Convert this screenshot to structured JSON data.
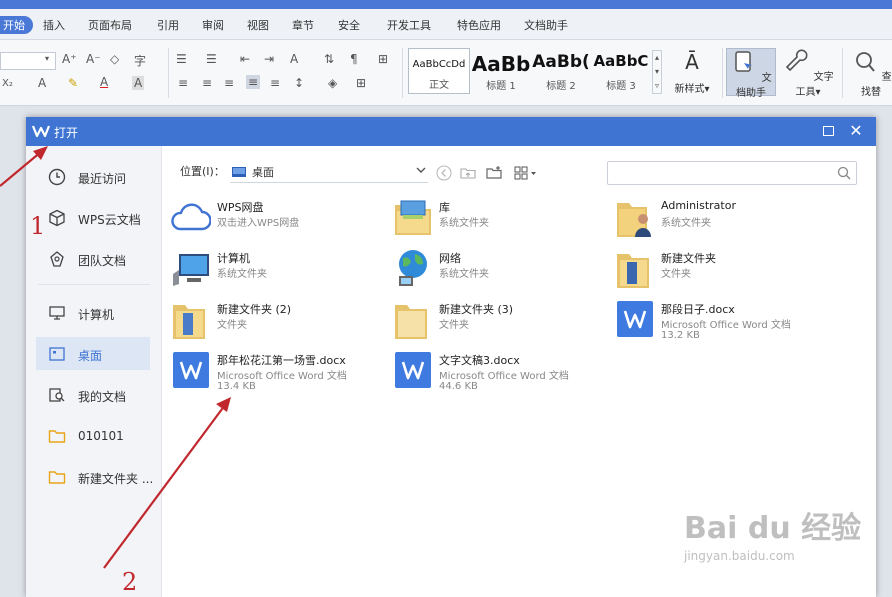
{
  "ribbon": {
    "menu": [
      "开始",
      "插入",
      "页面布局",
      "引用",
      "审阅",
      "视图",
      "章节",
      "安全",
      "开发工具",
      "特色应用",
      "文档助手"
    ],
    "styles": [
      {
        "sample": "AaBbCcDd",
        "name": "正文"
      },
      {
        "sample": "AaBb",
        "name": "标题 1"
      },
      {
        "sample": "AaBb(",
        "name": "标题 2"
      },
      {
        "sample": "AaBbC",
        "name": "标题 3"
      }
    ],
    "new_style": "新样式",
    "doc_helper": "文档助手",
    "text_tools": "文字工具",
    "find_replace": "查找替"
  },
  "dialog": {
    "title": "打开",
    "sidebar": [
      {
        "label": "最近访问",
        "icon": "clock-icon"
      },
      {
        "label": "WPS云文档",
        "icon": "cube-icon"
      },
      {
        "label": "团队文档",
        "icon": "team-icon"
      },
      {
        "label": "计算机",
        "icon": "monitor-icon"
      },
      {
        "label": "桌面",
        "icon": "desktop-icon"
      },
      {
        "label": "我的文档",
        "icon": "documents-icon"
      },
      {
        "label": "010101",
        "icon": "folder-icon"
      },
      {
        "label": "新建文件夹 ...",
        "icon": "folder-icon"
      }
    ],
    "location_label": "位置(I)：",
    "location_value": "桌面",
    "search_placeholder": "",
    "files": [
      {
        "name": "WPS网盘",
        "type": "双击进入WPS网盘",
        "size": "",
        "icon": "cloud-icon"
      },
      {
        "name": "库",
        "type": "系统文件夹",
        "size": "",
        "icon": "library-folder-icon"
      },
      {
        "name": "Administrator",
        "type": "系统文件夹",
        "size": "",
        "icon": "user-folder-icon"
      },
      {
        "name": "计算机",
        "type": "系统文件夹",
        "size": "",
        "icon": "computer-icon"
      },
      {
        "name": "网络",
        "type": "系统文件夹",
        "size": "",
        "icon": "network-globe-icon"
      },
      {
        "name": "新建文件夹",
        "type": "文件夹",
        "size": "",
        "icon": "folder-open-icon"
      },
      {
        "name": "新建文件夹 (2)",
        "type": "文件夹",
        "size": "",
        "icon": "folder-open-icon"
      },
      {
        "name": "新建文件夹 (3)",
        "type": "文件夹",
        "size": "",
        "icon": "folder-icon"
      },
      {
        "name": "那段日子.docx",
        "type": "Microsoft Office Word 文档",
        "size": "13.2 KB",
        "icon": "wps-doc-icon"
      },
      {
        "name": "那年松花江第一场雪.docx",
        "type": "Microsoft Office Word 文档",
        "size": "13.4 KB",
        "icon": "wps-doc-icon"
      },
      {
        "name": "文字文稿3.docx",
        "type": "Microsoft Office Word 文档",
        "size": "44.6 KB",
        "icon": "wps-doc-icon"
      }
    ]
  },
  "annotations": {
    "step1": "1",
    "step2": "2"
  },
  "watermark": {
    "brand": "Bai du 经验",
    "url": "jingyan.baidu.com"
  },
  "colors": {
    "accent": "#3f74d3",
    "annotation": "#c0282e"
  }
}
